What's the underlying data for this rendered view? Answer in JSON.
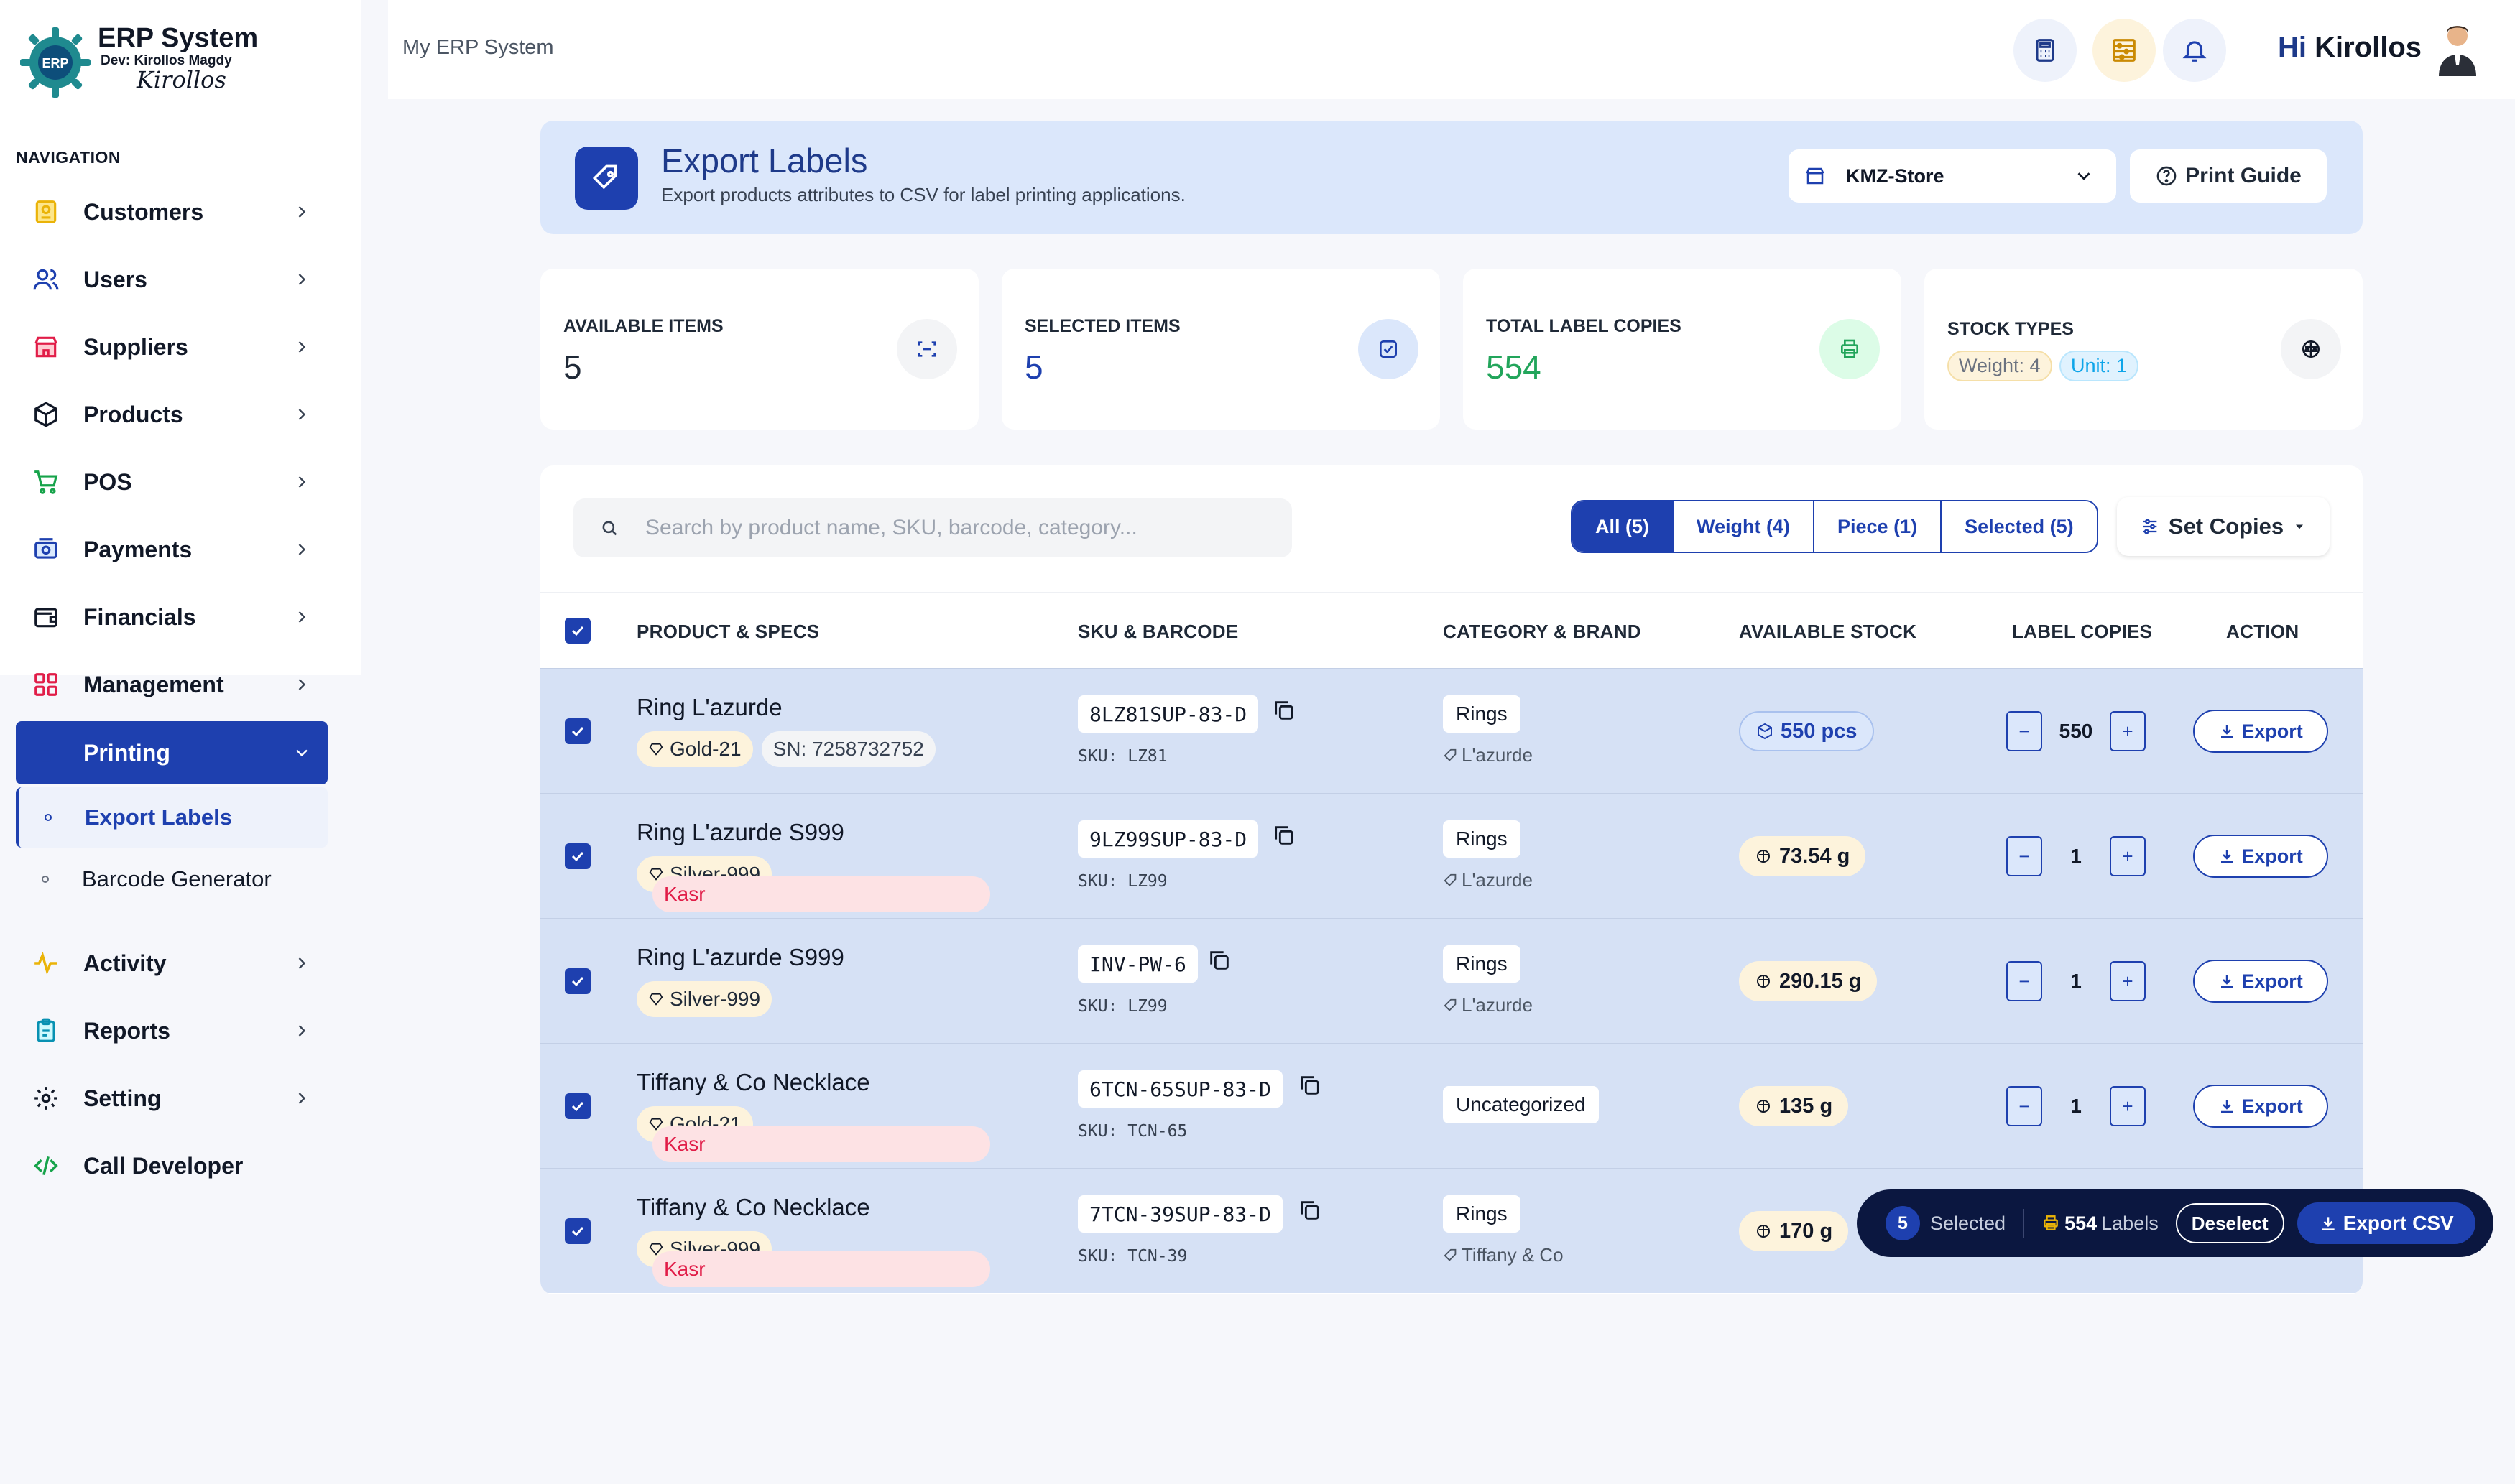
{
  "brand": {
    "title": "ERP System",
    "dev": "Dev: Kirollos Magdy",
    "signature": "Kirollos",
    "logo_text": "ERP"
  },
  "nav": {
    "heading": "NAVIGATION",
    "items": [
      {
        "label": "Customers",
        "icon": "id-card-icon"
      },
      {
        "label": "Users",
        "icon": "users-icon"
      },
      {
        "label": "Suppliers",
        "icon": "store-icon"
      },
      {
        "label": "Products",
        "icon": "box-icon"
      },
      {
        "label": "POS",
        "icon": "cart-icon"
      },
      {
        "label": "Payments",
        "icon": "payment-icon"
      },
      {
        "label": "Financials",
        "icon": "wallet-icon"
      },
      {
        "label": "Management",
        "icon": "grid-icon"
      },
      {
        "label": "Printing",
        "icon": "printer-icon"
      },
      {
        "label": "Activity",
        "icon": "activity-icon"
      },
      {
        "label": "Reports",
        "icon": "clipboard-icon"
      },
      {
        "label": "Setting",
        "icon": "gear-icon"
      },
      {
        "label": "Call Developer",
        "icon": "code-icon"
      }
    ],
    "sub_items": [
      {
        "label": "Export Labels"
      },
      {
        "label": "Barcode Generator"
      }
    ]
  },
  "topbar": {
    "breadcrumb": "My ERP System",
    "greeting_hi": "Hi",
    "user_name": "Kirollos"
  },
  "header": {
    "title": "Export Labels",
    "subtitle": "Export products attributes to CSV for label printing applications.",
    "store": "KMZ-Store",
    "guide_label": "Print Guide"
  },
  "stats": {
    "available": {
      "title": "AVAILABLE ITEMS",
      "value": "5"
    },
    "selected": {
      "title": "SELECTED ITEMS",
      "value": "5"
    },
    "copies": {
      "title": "TOTAL LABEL COPIES",
      "value": "554"
    },
    "types": {
      "title": "STOCK TYPES",
      "weight": "Weight: 4",
      "unit": "Unit: 1"
    }
  },
  "toolbar": {
    "search_placeholder": "Search by product name, SKU, barcode, category...",
    "filters": [
      "All (5)",
      "Weight (4)",
      "Piece (1)",
      "Selected (5)"
    ],
    "set_copies": "Set Copies"
  },
  "table": {
    "headers": [
      "PRODUCT & SPECS",
      "SKU & BARCODE",
      "CATEGORY & BRAND",
      "AVAILABLE STOCK",
      "LABEL COPIES",
      "ACTION"
    ],
    "export_label": "Export",
    "rows": [
      {
        "name": "Ring L'azurde",
        "metal": "Gold-21",
        "extra": "SN: 7258732752",
        "extra_type": "sn",
        "barcode": "8LZ81SUP-83-D",
        "sku": "SKU: LZ81",
        "category": "Rings",
        "brand": "L'azurde",
        "stock": "550 pcs",
        "stock_type": "pcs",
        "copies": "550"
      },
      {
        "name": "Ring L'azurde S999",
        "metal": "Silver-999",
        "extra": "Kasr",
        "extra_type": "brand",
        "barcode": "9LZ99SUP-83-D",
        "sku": "SKU: LZ99",
        "category": "Rings",
        "brand": "L'azurde",
        "stock": "73.54 g",
        "stock_type": "wt",
        "copies": "1"
      },
      {
        "name": "Ring L'azurde S999",
        "metal": "Silver-999",
        "extra": "",
        "extra_type": "",
        "barcode": "INV-PW-6",
        "sku": "SKU: LZ99",
        "category": "Rings",
        "brand": "L'azurde",
        "stock": "290.15 g",
        "stock_type": "wt",
        "copies": "1"
      },
      {
        "name": "Tiffany & Co Necklace",
        "metal": "Gold-21",
        "extra": "Kasr",
        "extra_type": "brand",
        "barcode": "6TCN-65SUP-83-D",
        "sku": "SKU: TCN-65",
        "category": "Uncategorized",
        "brand": "",
        "stock": "135 g",
        "stock_type": "wt",
        "copies": "1"
      },
      {
        "name": "Tiffany & Co Necklace",
        "metal": "Silver-999",
        "extra": "Kasr",
        "extra_type": "brand",
        "barcode": "7TCN-39SUP-83-D",
        "sku": "SKU: TCN-39",
        "category": "Rings",
        "brand": "Tiffany & Co",
        "stock": "170 g",
        "stock_type": "wt",
        "copies": ""
      }
    ]
  },
  "floatbar": {
    "count": "5",
    "selected_label": "Selected",
    "labels_value": "554",
    "labels_text": "Labels",
    "deselect": "Deselect",
    "export_csv": "Export CSV"
  },
  "colors": {
    "primary": "#1e40af",
    "row_bg": "#d6e1f5",
    "header_bg": "#dbe7fb",
    "accent_green": "#22a55b"
  }
}
